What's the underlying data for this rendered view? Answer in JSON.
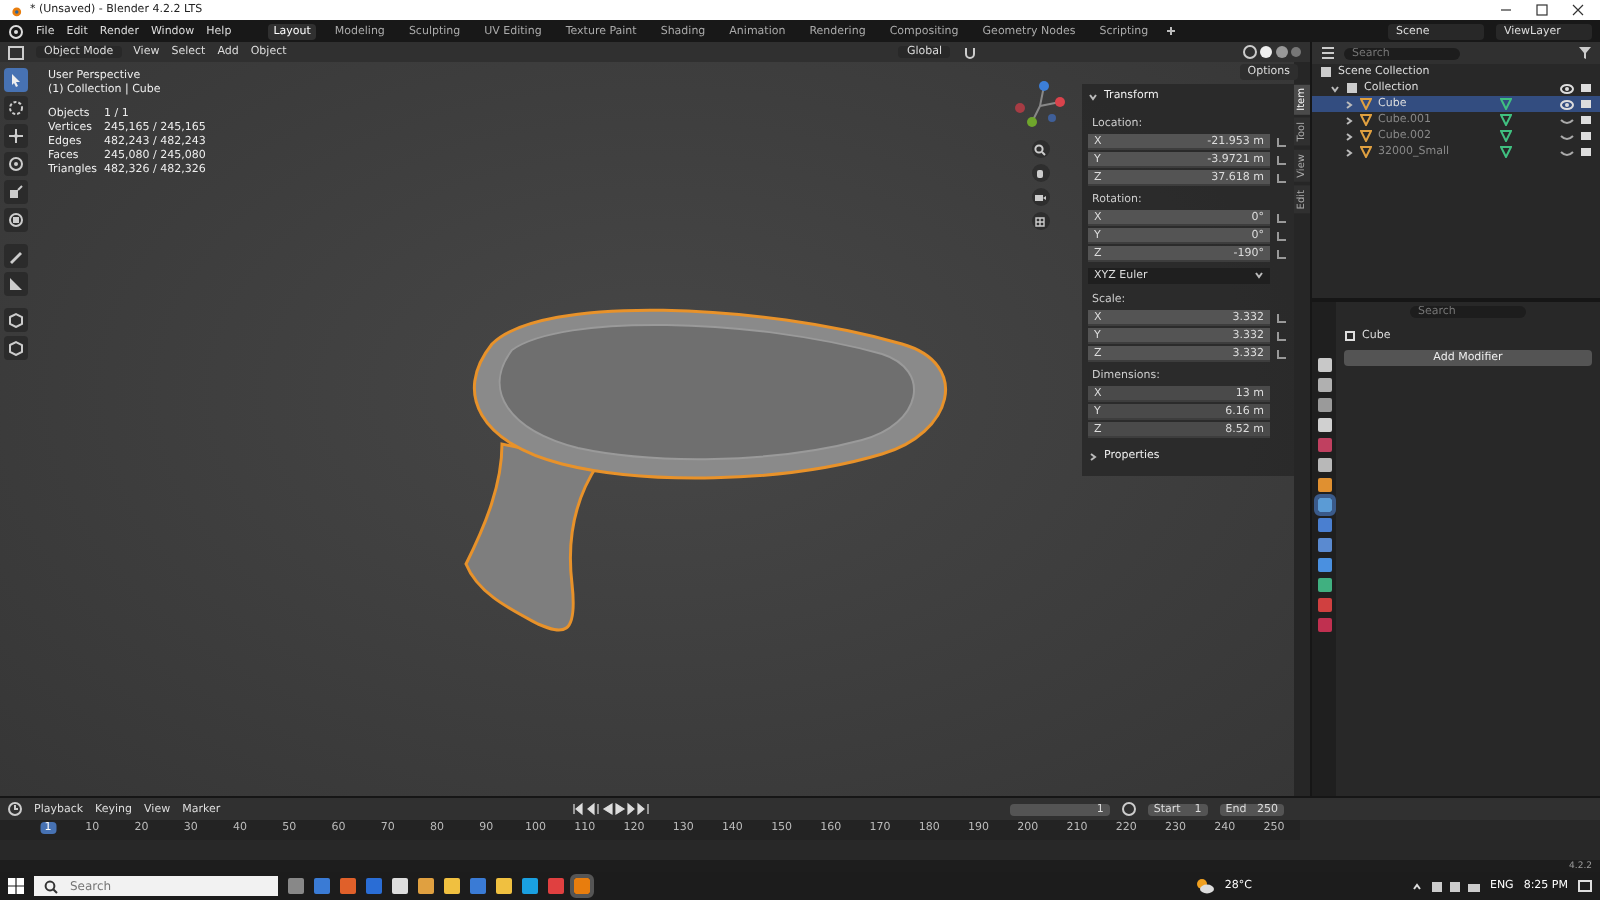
{
  "window": {
    "title": "* (Unsaved) - Blender 4.2.2 LTS"
  },
  "menu": [
    "File",
    "Edit",
    "Render",
    "Window",
    "Help"
  ],
  "workspaces": [
    {
      "label": "Layout",
      "selected": true
    },
    {
      "label": "Modeling",
      "selected": false
    },
    {
      "label": "Sculpting",
      "selected": false
    },
    {
      "label": "UV Editing",
      "selected": false
    },
    {
      "label": "Texture Paint",
      "selected": false
    },
    {
      "label": "Shading",
      "selected": false
    },
    {
      "label": "Animation",
      "selected": false
    },
    {
      "label": "Rendering",
      "selected": false
    },
    {
      "label": "Compositing",
      "selected": false
    },
    {
      "label": "Geometry Nodes",
      "selected": false
    },
    {
      "label": "Scripting",
      "selected": false
    }
  ],
  "scene": "Scene",
  "view_layer": "ViewLayer",
  "viewport": {
    "mode": "Object Mode",
    "menus": [
      "View",
      "Select",
      "Add",
      "Object"
    ],
    "orientation": "Global",
    "options": "Options",
    "view_name": "User Perspective",
    "context": "(1) Collection | Cube",
    "stats": [
      {
        "label": "Objects",
        "value": "1 / 1"
      },
      {
        "label": "Vertices",
        "value": "245,165 / 245,165"
      },
      {
        "label": "Edges",
        "value": "482,243 / 482,243"
      },
      {
        "label": "Faces",
        "value": "245,080 / 245,080"
      },
      {
        "label": "Triangles",
        "value": "482,326 / 482,326"
      }
    ],
    "tools": [
      {
        "kind": "cursor",
        "selected": true
      },
      {
        "kind": "circle",
        "selected": false
      },
      {
        "kind": "move",
        "selected": false
      },
      {
        "kind": "rotate",
        "selected": false
      },
      {
        "kind": "scale",
        "selected": false
      },
      {
        "kind": "transform",
        "selected": false
      },
      {
        "kind": "pencil",
        "selected": false
      },
      {
        "kind": "ruler",
        "selected": false
      },
      {
        "kind": "cube",
        "selected": false
      },
      {
        "kind": "cube",
        "selected": false
      }
    ],
    "sidebar_tabs": [
      {
        "label": "Item",
        "selected": true
      },
      {
        "label": "Tool",
        "selected": false
      },
      {
        "label": "View",
        "selected": false
      },
      {
        "label": "Edit",
        "selected": false
      }
    ],
    "transform": {
      "title": "Transform",
      "groups": [
        {
          "label": "Location:",
          "fields": [
            {
              "axis": "X",
              "value": "-21.953 m"
            },
            {
              "axis": "Y",
              "value": "-3.9721 m"
            },
            {
              "axis": "Z",
              "value": "37.618 m"
            }
          ]
        },
        {
          "label": "Rotation:",
          "fields": [
            {
              "axis": "X",
              "value": "0°"
            },
            {
              "axis": "Y",
              "value": "0°"
            },
            {
              "axis": "Z",
              "value": "-190°"
            }
          ],
          "mode": "XYZ Euler"
        },
        {
          "label": "Scale:",
          "fields": [
            {
              "axis": "X",
              "value": "3.332"
            },
            {
              "axis": "Y",
              "value": "3.332"
            },
            {
              "axis": "Z",
              "value": "3.332"
            }
          ]
        },
        {
          "label": "Dimensions:",
          "fields": [
            {
              "axis": "X",
              "value": "13 m"
            },
            {
              "axis": "Y",
              "value": "6.16 m"
            },
            {
              "axis": "Z",
              "value": "8.52 m"
            }
          ]
        }
      ],
      "properties": "Properties"
    }
  },
  "outliner": {
    "search_placeholder": "Search",
    "root": {
      "label": "Scene Collection",
      "children": [
        {
          "label": "Collection",
          "expanded": true,
          "visible": true,
          "children": [
            {
              "label": "Cube",
              "expanded": false,
              "visible": true,
              "selected": true
            },
            {
              "label": "Cube.001",
              "expanded": false,
              "visible": false,
              "selected": false
            },
            {
              "label": "Cube.002",
              "expanded": false,
              "visible": false,
              "selected": false
            },
            {
              "label": "32000_Small",
              "expanded": false,
              "visible": false,
              "selected": false
            }
          ]
        }
      ]
    }
  },
  "properties": {
    "search_placeholder": "Search",
    "object": "Cube",
    "add_modifier": "Add Modifier",
    "tabs": [
      {
        "color": "#c8c8c8",
        "selected": false
      },
      {
        "color": "#b0b0b0",
        "selected": false
      },
      {
        "color": "#9a9a9a",
        "selected": false
      },
      {
        "color": "#d0d0d0",
        "selected": false
      },
      {
        "color": "#c04060",
        "selected": false
      },
      {
        "color": "#b8b8b8",
        "selected": false
      },
      {
        "color": "#e09030",
        "selected": false
      },
      {
        "color": "#5b9bd5",
        "selected": true
      },
      {
        "color": "#4a7fd0",
        "selected": false
      },
      {
        "color": "#5a8ad0",
        "selected": false
      },
      {
        "color": "#4a90e0",
        "selected": false
      },
      {
        "color": "#40b080",
        "selected": false
      },
      {
        "color": "#d04040",
        "selected": false
      },
      {
        "color": "#c03050",
        "selected": false
      }
    ]
  },
  "timeline": {
    "menus": [
      "Playback",
      "Keying",
      "View",
      "Marker"
    ],
    "current_frame": "1",
    "start_label": "Start",
    "start": "1",
    "end_label": "End",
    "end": "250",
    "ticks": [
      "1",
      "10",
      "20",
      "30",
      "40",
      "50",
      "60",
      "70",
      "80",
      "90",
      "100",
      "110",
      "120",
      "130",
      "140",
      "150",
      "160",
      "170",
      "180",
      "190",
      "200",
      "210",
      "220",
      "230",
      "240",
      "250"
    ]
  },
  "version": "4.2.2",
  "taskbar": {
    "search_placeholder": "Search",
    "temperature": "28°C",
    "language": "ENG",
    "time": "8:25 PM"
  }
}
